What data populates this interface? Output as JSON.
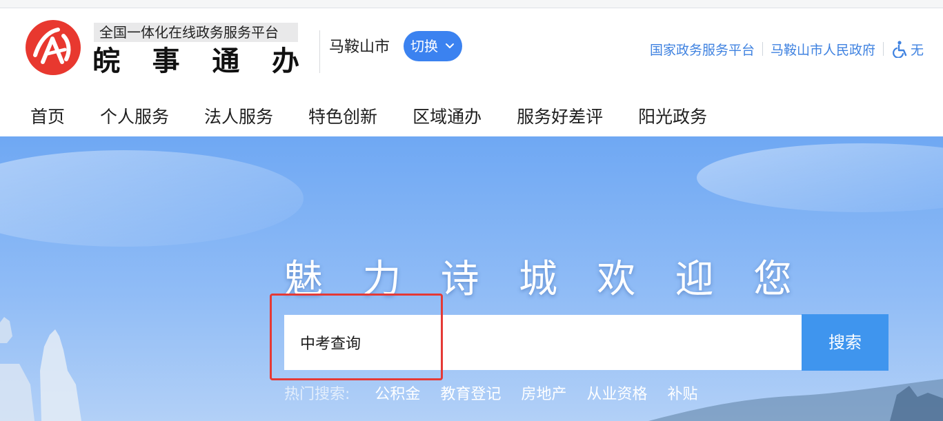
{
  "brand": {
    "subtitle": "全国一体化在线政务服务平台",
    "title_chars": [
      "皖",
      "事",
      "通",
      "办"
    ],
    "logo_color": "#e8382f"
  },
  "location": {
    "city": "马鞍山市",
    "switch_label": "切换"
  },
  "top_links": {
    "national_platform": "国家政务服务平台",
    "city_government": "马鞍山市人民政府",
    "accessibility": "无"
  },
  "nav": {
    "items": [
      {
        "label": "首页"
      },
      {
        "label": "个人服务"
      },
      {
        "label": "法人服务"
      },
      {
        "label": "特色创新"
      },
      {
        "label": "区域通办"
      },
      {
        "label": "服务好差评"
      },
      {
        "label": "阳光政务"
      }
    ]
  },
  "hero": {
    "title_chars": [
      "魅",
      "力",
      "诗",
      "城",
      "欢",
      "迎",
      "您"
    ]
  },
  "search": {
    "value": "中考查询",
    "button_label": "搜索"
  },
  "hot_search": {
    "label": "热门搜索:",
    "items": [
      "公积金",
      "教育登记",
      "房地产",
      "从业资格",
      "补贴"
    ]
  },
  "colors": {
    "accent": "#3b82f0",
    "link": "#3f82e0",
    "search_button": "#3f95ee",
    "highlight": "#e53935"
  }
}
